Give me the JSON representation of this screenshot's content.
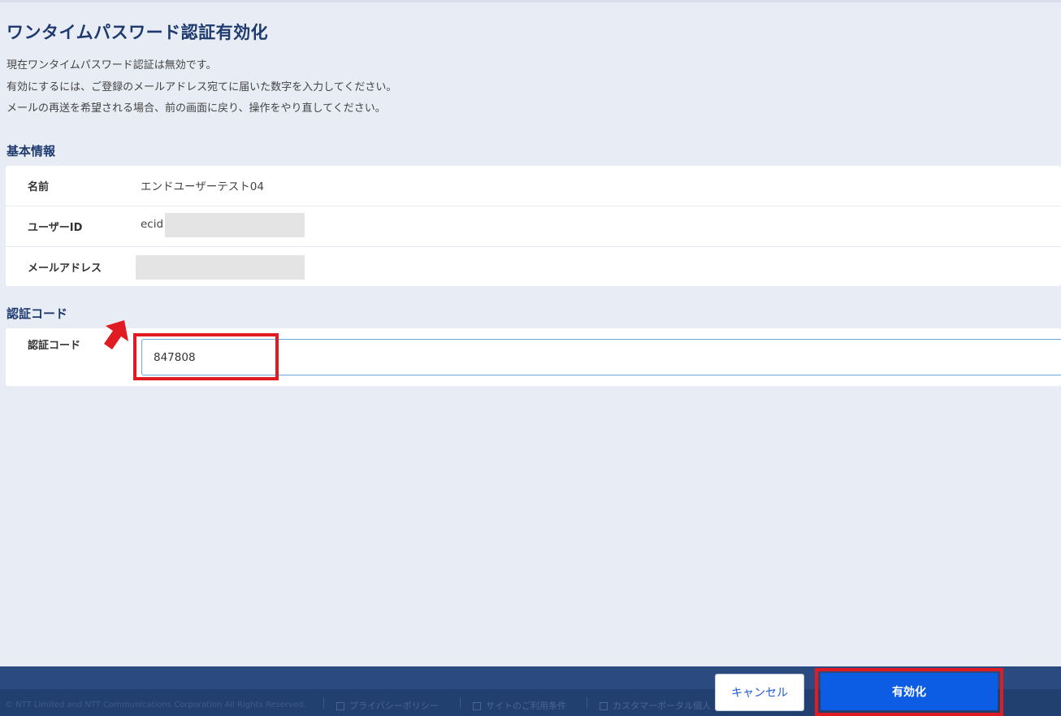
{
  "page": {
    "title": "ワンタイムパスワード認証有効化",
    "description": [
      "現在ワンタイムパスワード認証は無効です。",
      "有効にするには、ご登録のメールアドレス宛てに届いた数字を入力してください。",
      "メールの再送を希望される場合、前の画面に戻り、操作をやり直してください。"
    ]
  },
  "basic_info": {
    "section_title": "基本情報",
    "rows": [
      {
        "label": "名前",
        "value": "エンドユーザーテスト04"
      },
      {
        "label": "ユーザーID",
        "value": "ecid"
      },
      {
        "label": "メールアドレス",
        "value": ""
      }
    ]
  },
  "auth_code": {
    "section_title": "認証コード",
    "label": "認証コード",
    "value": "847808"
  },
  "buttons": {
    "cancel": "キャンセル",
    "activate": "有効化"
  },
  "footer": {
    "copyright": "© NTT Limited and NTT Communications Corporation All Rights Reserved.",
    "links": [
      "プライバシーポリシー",
      "サイトのご利用条件",
      "カスタマーポータル個人"
    ]
  },
  "colors": {
    "accent": "#0d5ce4",
    "title": "#1e3a6e",
    "highlight": "#e01b22",
    "footer": "#22406f"
  }
}
